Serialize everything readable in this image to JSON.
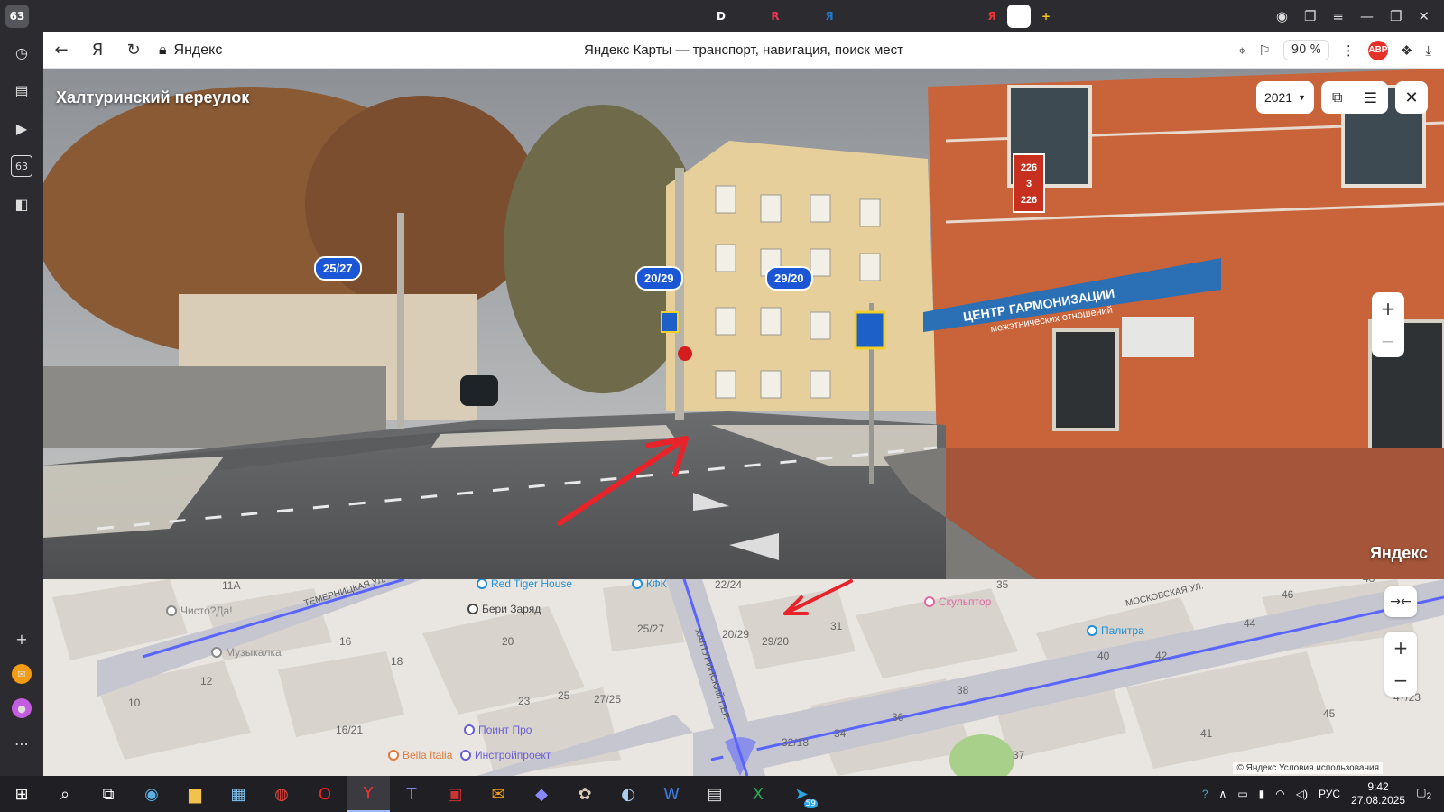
{
  "tabs": [
    {
      "label": "63",
      "icon": "counter-icon",
      "active": false
    },
    {
      "label": "",
      "icon": "chevron-down-icon"
    },
    {
      "label": "",
      "icon": "bag-icon"
    },
    {
      "label": "",
      "icon": "document-icon"
    },
    {
      "label": "",
      "icon": "site-icon"
    },
    {
      "label": "",
      "icon": "site-icon"
    },
    {
      "label": "",
      "icon": "site-icon"
    },
    {
      "label": "",
      "icon": "site-icon"
    },
    {
      "label": "",
      "icon": "site-icon"
    },
    {
      "label": "",
      "icon": "site-icon"
    },
    {
      "label": "",
      "icon": "scissors-icon"
    },
    {
      "label": "",
      "icon": "site-icon"
    },
    {
      "label": "",
      "icon": "site-icon"
    },
    {
      "label": "",
      "icon": "site-icon"
    },
    {
      "label": "",
      "icon": "sparkle-icon"
    },
    {
      "label": "",
      "icon": "vk-icon"
    },
    {
      "label": "",
      "icon": "play-icon"
    },
    {
      "label": "",
      "icon": "site-icon"
    },
    {
      "label": "",
      "icon": "site-icon"
    },
    {
      "label": "",
      "icon": "sparkle-icon"
    },
    {
      "label": "",
      "icon": "sparkle-icon"
    },
    {
      "label": "",
      "icon": "site-icon"
    },
    {
      "label": "",
      "icon": "site-icon"
    },
    {
      "label": "",
      "icon": "site-icon"
    },
    {
      "label": "",
      "icon": "site-icon"
    },
    {
      "label": "",
      "icon": "site-icon"
    },
    {
      "label": "D",
      "icon": "site-icon"
    },
    {
      "label": "",
      "icon": "back-icon"
    },
    {
      "label": "R",
      "icon": "site-icon"
    },
    {
      "label": "",
      "icon": "site-icon"
    },
    {
      "label": "Я",
      "icon": "site-icon"
    },
    {
      "label": "",
      "icon": "map-pin-icon"
    },
    {
      "label": "",
      "icon": "document-icon"
    },
    {
      "label": "",
      "icon": "site-icon"
    },
    {
      "label": "",
      "icon": "site-icon"
    },
    {
      "label": "",
      "icon": "site-icon"
    },
    {
      "label": "Я",
      "icon": "site-icon"
    },
    {
      "label": "",
      "icon": "map-pin-icon",
      "active": true
    },
    {
      "label": "+",
      "icon": "new-tab-icon"
    }
  ],
  "browser": {
    "site_name": "Яндекс",
    "page_title": "Яндекс Карты — транспорт, навигация, поиск мест",
    "zoom": "90 %",
    "abp": "ABP"
  },
  "panorama": {
    "street_name": "Халтуринский переулок",
    "year": "2021",
    "house_badges": [
      "25/27",
      "20/29",
      "29/20"
    ],
    "logo": "Яндекс",
    "sign_text": [
      "ЦЕНТР ГАРМОНИЗАЦИИ",
      "межэтнических отношений"
    ],
    "plate": [
      "226",
      "3",
      "226"
    ]
  },
  "map": {
    "streets": [
      "ТЕМЕРНИЦКАЯ УЛ.",
      "МОСКОВСКАЯ УЛ.",
      "ХАЛТУРИНСКИЙ ПЕР."
    ],
    "houses": [
      "11А",
      "16",
      "18",
      "12",
      "10",
      "20",
      "23",
      "25",
      "27/25",
      "16/21",
      "25/27",
      "20/29",
      "29/20",
      "31",
      "22/24",
      "35",
      "40",
      "42",
      "38",
      "36",
      "34",
      "32/18",
      "41",
      "44",
      "45",
      "46",
      "48",
      "47/23",
      "37"
    ],
    "pois": [
      {
        "name": "Red Tiger House",
        "color": "#1f8fd6"
      },
      {
        "name": "КФК",
        "color": "#1f8fd6"
      },
      {
        "name": "Бери Заряд",
        "color": "#444"
      },
      {
        "name": "Чисто?Да!",
        "color": "#888"
      },
      {
        "name": "Музыкалка",
        "color": "#888"
      },
      {
        "name": "Скульптор",
        "color": "#e06aa4"
      },
      {
        "name": "Палитра",
        "color": "#1f8fd6"
      },
      {
        "name": "Поинт Про",
        "color": "#6a5fd6"
      },
      {
        "name": "Bella Italia",
        "color": "#e07a3a"
      },
      {
        "name": "Инстройпроект",
        "color": "#6a5fd6"
      }
    ],
    "copyright": "© Яндекс   Условия использования"
  },
  "taskbar": {
    "lang": "РУС",
    "time": "9:42",
    "date": "27.08.2025",
    "notif": "2",
    "badge": "59"
  },
  "colors": {
    "annotation": "#e8242b",
    "badge": "#1a56d6",
    "route": "#5a64ff"
  }
}
